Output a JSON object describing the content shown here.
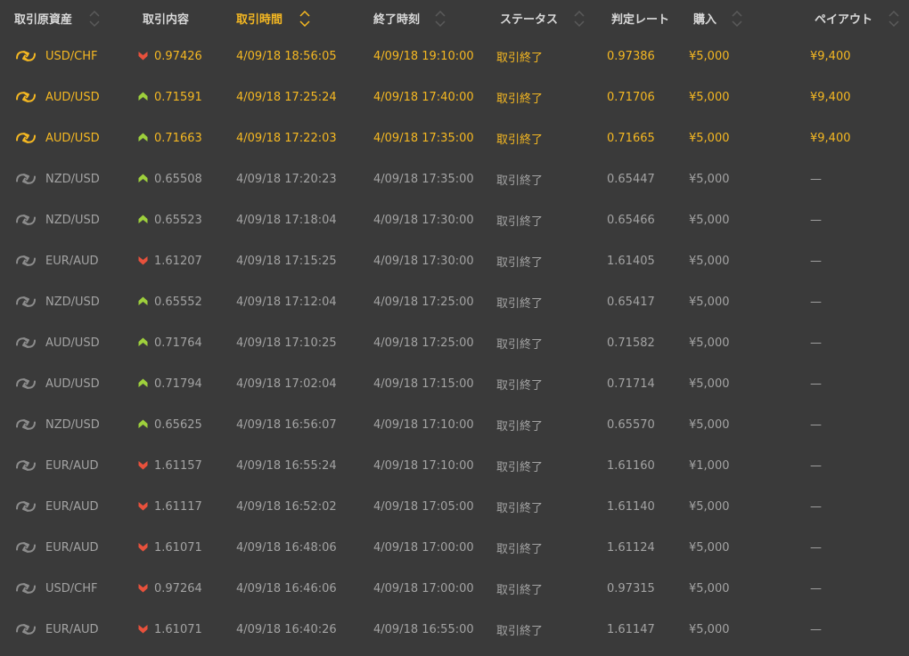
{
  "colors": {
    "background": "#3a3a3a",
    "highlight": "#f5b822",
    "text": "#a3a3a3",
    "header_text": "#d9d9d9",
    "up": "#9ed03c",
    "down": "#e8513c"
  },
  "columns": [
    {
      "key": "asset",
      "label": "取引原資産",
      "active": false
    },
    {
      "key": "direction",
      "label": "取引内容",
      "active": false
    },
    {
      "key": "trade_time",
      "label": "取引時間",
      "active": true
    },
    {
      "key": "end_time",
      "label": "終了時刻",
      "active": false
    },
    {
      "key": "status",
      "label": "ステータス",
      "active": false
    },
    {
      "key": "rate",
      "label": "判定レート",
      "active": false
    },
    {
      "key": "purchase",
      "label": "購入",
      "active": false
    },
    {
      "key": "payout",
      "label": "ペイアウト",
      "active": false
    }
  ],
  "rows": [
    {
      "asset": "USD/CHF",
      "direction": "down",
      "icon": "down-arrow-icon",
      "entry": "0.97426",
      "trade_time": "4/09/18 18:56:05",
      "end_time": "4/09/18 19:10:00",
      "status": "取引終了",
      "rate": "0.97386",
      "purchase": "¥5,000",
      "payout": "¥9,400",
      "won": true
    },
    {
      "asset": "AUD/USD",
      "direction": "up",
      "icon": "up-arrow-icon",
      "entry": "0.71591",
      "trade_time": "4/09/18 17:25:24",
      "end_time": "4/09/18 17:40:00",
      "status": "取引終了",
      "rate": "0.71706",
      "purchase": "¥5,000",
      "payout": "¥9,400",
      "won": true
    },
    {
      "asset": "AUD/USD",
      "direction": "up",
      "icon": "up-arrow-icon",
      "entry": "0.71663",
      "trade_time": "4/09/18 17:22:03",
      "end_time": "4/09/18 17:35:00",
      "status": "取引終了",
      "rate": "0.71665",
      "purchase": "¥5,000",
      "payout": "¥9,400",
      "won": true
    },
    {
      "asset": "NZD/USD",
      "direction": "up",
      "icon": "up-arrow-icon",
      "entry": "0.65508",
      "trade_time": "4/09/18 17:20:23",
      "end_time": "4/09/18 17:35:00",
      "status": "取引終了",
      "rate": "0.65447",
      "purchase": "¥5,000",
      "payout": "—",
      "won": false
    },
    {
      "asset": "NZD/USD",
      "direction": "up",
      "icon": "up-arrow-icon",
      "entry": "0.65523",
      "trade_time": "4/09/18 17:18:04",
      "end_time": "4/09/18 17:30:00",
      "status": "取引終了",
      "rate": "0.65466",
      "purchase": "¥5,000",
      "payout": "—",
      "won": false
    },
    {
      "asset": "EUR/AUD",
      "direction": "down",
      "icon": "down-arrow-icon",
      "entry": "1.61207",
      "trade_time": "4/09/18 17:15:25",
      "end_time": "4/09/18 17:30:00",
      "status": "取引終了",
      "rate": "1.61405",
      "purchase": "¥5,000",
      "payout": "—",
      "won": false
    },
    {
      "asset": "NZD/USD",
      "direction": "up",
      "icon": "up-arrow-icon",
      "entry": "0.65552",
      "trade_time": "4/09/18 17:12:04",
      "end_time": "4/09/18 17:25:00",
      "status": "取引終了",
      "rate": "0.65417",
      "purchase": "¥5,000",
      "payout": "—",
      "won": false
    },
    {
      "asset": "AUD/USD",
      "direction": "up",
      "icon": "up-arrow-icon",
      "entry": "0.71764",
      "trade_time": "4/09/18 17:10:25",
      "end_time": "4/09/18 17:25:00",
      "status": "取引終了",
      "rate": "0.71582",
      "purchase": "¥5,000",
      "payout": "—",
      "won": false
    },
    {
      "asset": "AUD/USD",
      "direction": "up",
      "icon": "up-arrow-icon",
      "entry": "0.71794",
      "trade_time": "4/09/18 17:02:04",
      "end_time": "4/09/18 17:15:00",
      "status": "取引終了",
      "rate": "0.71714",
      "purchase": "¥5,000",
      "payout": "—",
      "won": false
    },
    {
      "asset": "NZD/USD",
      "direction": "up",
      "icon": "up-arrow-icon",
      "entry": "0.65625",
      "trade_time": "4/09/18 16:56:07",
      "end_time": "4/09/18 17:10:00",
      "status": "取引終了",
      "rate": "0.65570",
      "purchase": "¥5,000",
      "payout": "—",
      "won": false
    },
    {
      "asset": "EUR/AUD",
      "direction": "down",
      "icon": "down-arrow-icon",
      "entry": "1.61157",
      "trade_time": "4/09/18 16:55:24",
      "end_time": "4/09/18 17:10:00",
      "status": "取引終了",
      "rate": "1.61160",
      "purchase": "¥1,000",
      "payout": "—",
      "won": false
    },
    {
      "asset": "EUR/AUD",
      "direction": "down",
      "icon": "down-arrow-icon",
      "entry": "1.61117",
      "trade_time": "4/09/18 16:52:02",
      "end_time": "4/09/18 17:05:00",
      "status": "取引終了",
      "rate": "1.61140",
      "purchase": "¥5,000",
      "payout": "—",
      "won": false
    },
    {
      "asset": "EUR/AUD",
      "direction": "down",
      "icon": "down-arrow-icon",
      "entry": "1.61071",
      "trade_time": "4/09/18 16:48:06",
      "end_time": "4/09/18 17:00:00",
      "status": "取引終了",
      "rate": "1.61124",
      "purchase": "¥5,000",
      "payout": "—",
      "won": false
    },
    {
      "asset": "USD/CHF",
      "direction": "down",
      "icon": "down-arrow-icon",
      "entry": "0.97264",
      "trade_time": "4/09/18 16:46:06",
      "end_time": "4/09/18 17:00:00",
      "status": "取引終了",
      "rate": "0.97315",
      "purchase": "¥5,000",
      "payout": "—",
      "won": false
    },
    {
      "asset": "EUR/AUD",
      "direction": "down",
      "icon": "down-arrow-icon",
      "entry": "1.61071",
      "trade_time": "4/09/18 16:40:26",
      "end_time": "4/09/18 16:55:00",
      "status": "取引終了",
      "rate": "1.61147",
      "purchase": "¥5,000",
      "payout": "—",
      "won": false
    }
  ]
}
